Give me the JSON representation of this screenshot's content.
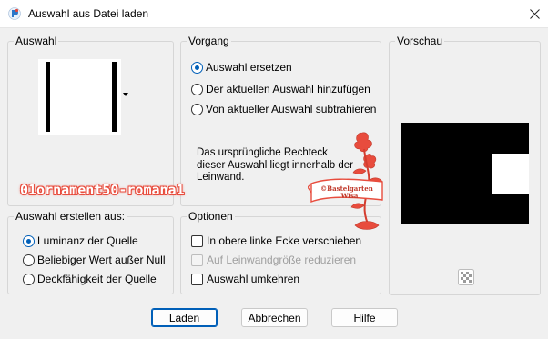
{
  "window": {
    "title": "Auswahl aus Datei laden",
    "close_icon": "close-icon",
    "app_icon": "paintshop-icon"
  },
  "auswahl": {
    "label": "Auswahl",
    "dropdown_icon": "caret-down-icon"
  },
  "vorgang": {
    "label": "Vorgang",
    "options": [
      {
        "label": "Auswahl ersetzen",
        "selected": true
      },
      {
        "label": "Der aktuellen Auswahl hinzufügen",
        "selected": false
      },
      {
        "label": "Von aktueller Auswahl subtrahieren",
        "selected": false
      }
    ],
    "info": "Das ursprüngliche Rechteck dieser Auswahl liegt innerhalb der Leinwand."
  },
  "vorschau": {
    "label": "Vorschau",
    "transparency_icon": "checkerboard-icon"
  },
  "erstellen": {
    "label": "Auswahl erstellen aus:",
    "options": [
      {
        "label": "Luminanz der Quelle",
        "selected": true
      },
      {
        "label": "Beliebiger Wert außer Null",
        "selected": false
      },
      {
        "label": "Deckfähigkeit der Quelle",
        "selected": false
      }
    ]
  },
  "optionen": {
    "label": "Optionen",
    "checks": [
      {
        "label": "In obere linke Ecke verschieben",
        "checked": false,
        "disabled": false
      },
      {
        "label": "Auf Leinwandgröße reduzieren",
        "checked": false,
        "disabled": true
      },
      {
        "label": "Auswahl umkehren",
        "checked": false,
        "disabled": false
      }
    ]
  },
  "buttons": {
    "laden": "Laden",
    "abbrechen": "Abbrechen",
    "hilfe": "Hilfe"
  },
  "watermark": {
    "filename": "01ornament50-romana1",
    "stamp_line1": "©Bastelgarten",
    "stamp_line2": "Wisa"
  },
  "colors": {
    "accent": "#005fb8",
    "watermark": "#e84c3d"
  }
}
